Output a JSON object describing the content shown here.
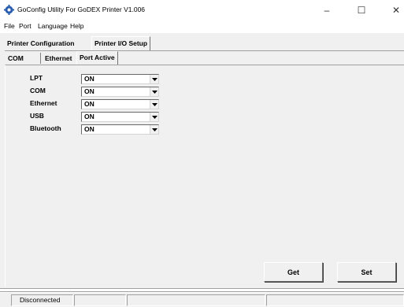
{
  "window": {
    "title": "GoConfig Utility For GoDEX Printer  V1.006",
    "minimize_glyph": "–",
    "maximize_glyph": "☐",
    "close_glyph": "✕"
  },
  "menu": [
    "File",
    "Port",
    "Language",
    "Help"
  ],
  "main_tabs": [
    "Printer Configuration",
    "Printer I/O Setup"
  ],
  "sub_tabs": [
    "COM",
    "Ethernet",
    "Port Active"
  ],
  "ports": [
    {
      "label": "LPT",
      "value": "ON"
    },
    {
      "label": "COM",
      "value": "ON"
    },
    {
      "label": "Ethernet",
      "value": "ON"
    },
    {
      "label": "USB",
      "value": "ON"
    },
    {
      "label": "Bluetooth",
      "value": "ON"
    }
  ],
  "buttons": {
    "get": "Get",
    "set": "Set"
  },
  "status": {
    "connection": "Disconnected"
  },
  "icons": {
    "app": "gear-icon",
    "dropdown": "chevron-down-icon"
  },
  "colors": {
    "face": "#f0f0f0",
    "app_icon": "#2a5db0"
  }
}
